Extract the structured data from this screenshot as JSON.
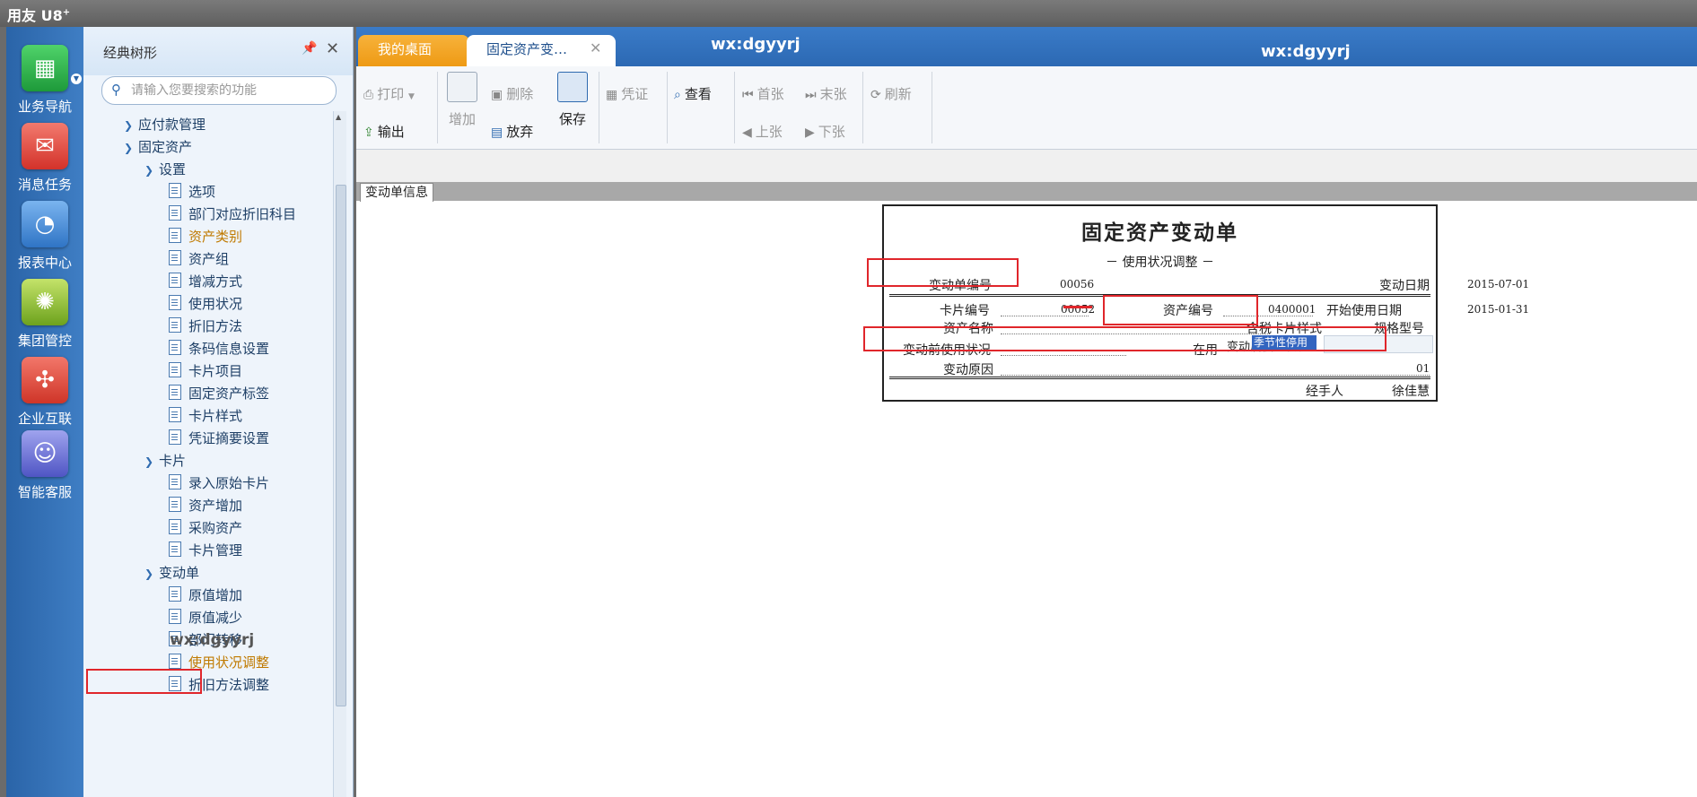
{
  "app": {
    "title": "用友",
    "title_brand": "U8",
    "title_sup": "+"
  },
  "left_nav": [
    {
      "label": "业务导航",
      "icon": "business-nav-icon",
      "color": "#2ea84a"
    },
    {
      "label": "消息任务",
      "icon": "message-task-icon",
      "color": "#e0453a"
    },
    {
      "label": "报表中心",
      "icon": "report-center-icon",
      "color": "#3b86d6"
    },
    {
      "label": "集团管控",
      "icon": "group-control-icon",
      "color": "#8cbc2c"
    },
    {
      "label": "企业互联",
      "icon": "enterprise-link-icon",
      "color": "#e2493a"
    },
    {
      "label": "智能客服",
      "icon": "smart-service-icon",
      "color": "#6a6fd6"
    }
  ],
  "tree": {
    "title": "经典树形",
    "search_placeholder": "请输入您要搜索的功能",
    "nodes": [
      {
        "label": "应付款管理",
        "type": "folder",
        "expanded": false
      },
      {
        "label": "固定资产",
        "type": "folder",
        "expanded": true
      },
      {
        "label": "设置",
        "type": "folder",
        "expanded": true
      },
      {
        "label": "选项",
        "type": "leaf"
      },
      {
        "label": "部门对应折旧科目",
        "type": "leaf"
      },
      {
        "label": "资产类别",
        "type": "leaf",
        "highlight": true
      },
      {
        "label": "资产组",
        "type": "leaf"
      },
      {
        "label": "增减方式",
        "type": "leaf"
      },
      {
        "label": "使用状况",
        "type": "leaf"
      },
      {
        "label": "折旧方法",
        "type": "leaf"
      },
      {
        "label": "条码信息设置",
        "type": "leaf"
      },
      {
        "label": "卡片项目",
        "type": "leaf"
      },
      {
        "label": "固定资产标签",
        "type": "leaf"
      },
      {
        "label": "卡片样式",
        "type": "leaf"
      },
      {
        "label": "凭证摘要设置",
        "type": "leaf"
      },
      {
        "label": "卡片",
        "type": "folder",
        "expanded": true
      },
      {
        "label": "录入原始卡片",
        "type": "leaf"
      },
      {
        "label": "资产增加",
        "type": "leaf"
      },
      {
        "label": "采购资产",
        "type": "leaf"
      },
      {
        "label": "卡片管理",
        "type": "leaf"
      },
      {
        "label": "变动单",
        "type": "folder",
        "expanded": true
      },
      {
        "label": "原值增加",
        "type": "leaf"
      },
      {
        "label": "原值减少",
        "type": "leaf"
      },
      {
        "label": "部门转移",
        "type": "leaf"
      },
      {
        "label": "使用状况调整",
        "type": "leaf",
        "highlight": true,
        "boxed": true
      },
      {
        "label": "折旧方法调整",
        "type": "leaf"
      }
    ]
  },
  "tabs": {
    "desktop": "我的桌面",
    "active": "固定资产变…"
  },
  "watermark": "wx:dgyyrj",
  "toolbar": {
    "print": "打印",
    "export": "输出",
    "add": "增加",
    "delete": "删除",
    "discard": "放弃",
    "save": "保存",
    "voucher": "凭证",
    "view": "查看",
    "first": "首张",
    "last": "末张",
    "prev": "上张",
    "next": "下张",
    "refresh": "刷新"
  },
  "info_tab": "变动单信息",
  "form": {
    "title": "固定资产变动单",
    "subtitle": "－ 使用状况调整 －",
    "change_no_label": "变动单编号",
    "change_no": "00056",
    "change_date_label": "变动日期",
    "change_date": "2015-07-01",
    "card_no_label": "卡片编号",
    "card_no": "00052",
    "asset_no_label": "资产编号",
    "asset_no": "0400001",
    "start_date_label": "开始使用日期",
    "start_date": "2015-01-31",
    "asset_name_label": "资产名称",
    "tax_card_label": "含税卡片样式",
    "spec_label": "规格型号",
    "usage_before_label": "变动前使用状况",
    "usage_before": "在用",
    "usage_after_label": "变动后使用状况",
    "usage_after": "季节性停用",
    "reason_label": "变动原因",
    "reason": "01",
    "handler_label": "经手人",
    "handler": "徐佳慧"
  },
  "colors": {
    "tab_bar": "#2c69b3",
    "highlight_box": "#e0262b",
    "selected_text": "#c07a00"
  }
}
